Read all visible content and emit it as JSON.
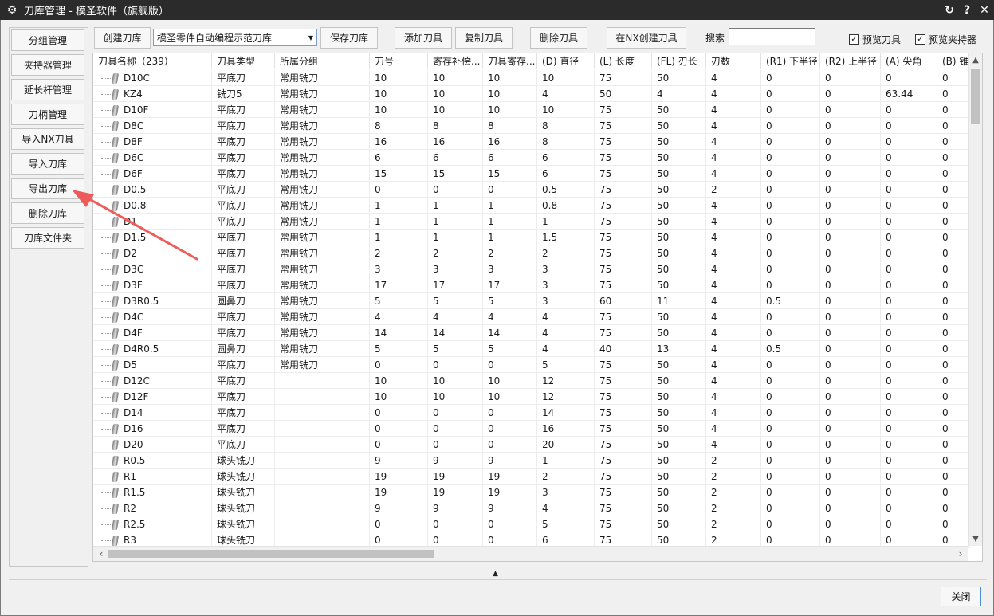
{
  "window": {
    "title": "刀库管理 - 模圣软件（旗舰版）",
    "controls": [
      "↻",
      "?",
      "✕"
    ]
  },
  "sidebar": {
    "items": [
      {
        "label": "分组管理"
      },
      {
        "label": "夹持器管理"
      },
      {
        "label": "延长杆管理"
      },
      {
        "label": "刀柄管理"
      },
      {
        "label": "导入NX刀具"
      },
      {
        "label": "导入刀库"
      },
      {
        "label": "导出刀库"
      },
      {
        "label": "删除刀库"
      },
      {
        "label": "刀库文件夹"
      }
    ]
  },
  "toolbar": {
    "create_library": "创建刀库",
    "library_select": "模圣零件自动编程示范刀库",
    "save_library": "保存刀库",
    "add_tool": "添加刀具",
    "copy_tool": "复制刀具",
    "delete_tool": "删除刀具",
    "create_in_nx": "在NX创建刀具",
    "search_label": "搜索",
    "search_value": "",
    "preview_tool": "预览刀具",
    "preview_holder": "预览夹持器"
  },
  "table": {
    "columns": [
      "刀具名称（239）",
      "刀具类型",
      "所属分组",
      "刀号",
      "寄存补偿...",
      "刀具寄存...",
      "(D) 直径",
      "(L) 长度",
      "(FL) 刃长",
      "刃数",
      "(R1) 下半径",
      "(R2) 上半径",
      "(A) 尖角",
      "(B) 锥角"
    ],
    "rows": [
      [
        "D10C",
        "平底刀",
        "常用铣刀",
        "10",
        "10",
        "10",
        "10",
        "75",
        "50",
        "4",
        "0",
        "0",
        "0",
        "0"
      ],
      [
        "KZ4",
        "铣刀5",
        "常用铣刀",
        "10",
        "10",
        "10",
        "4",
        "50",
        "4",
        "4",
        "0",
        "0",
        "63.44",
        "0"
      ],
      [
        "D10F",
        "平底刀",
        "常用铣刀",
        "10",
        "10",
        "10",
        "10",
        "75",
        "50",
        "4",
        "0",
        "0",
        "0",
        "0"
      ],
      [
        "D8C",
        "平底刀",
        "常用铣刀",
        "8",
        "8",
        "8",
        "8",
        "75",
        "50",
        "4",
        "0",
        "0",
        "0",
        "0"
      ],
      [
        "D8F",
        "平底刀",
        "常用铣刀",
        "16",
        "16",
        "16",
        "8",
        "75",
        "50",
        "4",
        "0",
        "0",
        "0",
        "0"
      ],
      [
        "D6C",
        "平底刀",
        "常用铣刀",
        "6",
        "6",
        "6",
        "6",
        "75",
        "50",
        "4",
        "0",
        "0",
        "0",
        "0"
      ],
      [
        "D6F",
        "平底刀",
        "常用铣刀",
        "15",
        "15",
        "15",
        "6",
        "75",
        "50",
        "4",
        "0",
        "0",
        "0",
        "0"
      ],
      [
        "D0.5",
        "平底刀",
        "常用铣刀",
        "0",
        "0",
        "0",
        "0.5",
        "75",
        "50",
        "2",
        "0",
        "0",
        "0",
        "0"
      ],
      [
        "D0.8",
        "平底刀",
        "常用铣刀",
        "1",
        "1",
        "1",
        "0.8",
        "75",
        "50",
        "4",
        "0",
        "0",
        "0",
        "0"
      ],
      [
        "D1",
        "平底刀",
        "常用铣刀",
        "1",
        "1",
        "1",
        "1",
        "75",
        "50",
        "4",
        "0",
        "0",
        "0",
        "0"
      ],
      [
        "D1.5",
        "平底刀",
        "常用铣刀",
        "1",
        "1",
        "1",
        "1.5",
        "75",
        "50",
        "4",
        "0",
        "0",
        "0",
        "0"
      ],
      [
        "D2",
        "平底刀",
        "常用铣刀",
        "2",
        "2",
        "2",
        "2",
        "75",
        "50",
        "4",
        "0",
        "0",
        "0",
        "0"
      ],
      [
        "D3C",
        "平底刀",
        "常用铣刀",
        "3",
        "3",
        "3",
        "3",
        "75",
        "50",
        "4",
        "0",
        "0",
        "0",
        "0"
      ],
      [
        "D3F",
        "平底刀",
        "常用铣刀",
        "17",
        "17",
        "17",
        "3",
        "75",
        "50",
        "4",
        "0",
        "0",
        "0",
        "0"
      ],
      [
        "D3R0.5",
        "圆鼻刀",
        "常用铣刀",
        "5",
        "5",
        "5",
        "3",
        "60",
        "11",
        "4",
        "0.5",
        "0",
        "0",
        "0"
      ],
      [
        "D4C",
        "平底刀",
        "常用铣刀",
        "4",
        "4",
        "4",
        "4",
        "75",
        "50",
        "4",
        "0",
        "0",
        "0",
        "0"
      ],
      [
        "D4F",
        "平底刀",
        "常用铣刀",
        "14",
        "14",
        "14",
        "4",
        "75",
        "50",
        "4",
        "0",
        "0",
        "0",
        "0"
      ],
      [
        "D4R0.5",
        "圆鼻刀",
        "常用铣刀",
        "5",
        "5",
        "5",
        "4",
        "40",
        "13",
        "4",
        "0.5",
        "0",
        "0",
        "0"
      ],
      [
        "D5",
        "平底刀",
        "常用铣刀",
        "0",
        "0",
        "0",
        "5",
        "75",
        "50",
        "4",
        "0",
        "0",
        "0",
        "0"
      ],
      [
        "D12C",
        "平底刀",
        "",
        "10",
        "10",
        "10",
        "12",
        "75",
        "50",
        "4",
        "0",
        "0",
        "0",
        "0"
      ],
      [
        "D12F",
        "平底刀",
        "",
        "10",
        "10",
        "10",
        "12",
        "75",
        "50",
        "4",
        "0",
        "0",
        "0",
        "0"
      ],
      [
        "D14",
        "平底刀",
        "",
        "0",
        "0",
        "0",
        "14",
        "75",
        "50",
        "4",
        "0",
        "0",
        "0",
        "0"
      ],
      [
        "D16",
        "平底刀",
        "",
        "0",
        "0",
        "0",
        "16",
        "75",
        "50",
        "4",
        "0",
        "0",
        "0",
        "0"
      ],
      [
        "D20",
        "平底刀",
        "",
        "0",
        "0",
        "0",
        "20",
        "75",
        "50",
        "4",
        "0",
        "0",
        "0",
        "0"
      ],
      [
        "R0.5",
        "球头铣刀",
        "",
        "9",
        "9",
        "9",
        "1",
        "75",
        "50",
        "2",
        "0",
        "0",
        "0",
        "0"
      ],
      [
        "R1",
        "球头铣刀",
        "",
        "19",
        "19",
        "19",
        "2",
        "75",
        "50",
        "2",
        "0",
        "0",
        "0",
        "0"
      ],
      [
        "R1.5",
        "球头铣刀",
        "",
        "19",
        "19",
        "19",
        "3",
        "75",
        "50",
        "2",
        "0",
        "0",
        "0",
        "0"
      ],
      [
        "R2",
        "球头铣刀",
        "",
        "9",
        "9",
        "9",
        "4",
        "75",
        "50",
        "2",
        "0",
        "0",
        "0",
        "0"
      ],
      [
        "R2.5",
        "球头铣刀",
        "",
        "0",
        "0",
        "0",
        "5",
        "75",
        "50",
        "2",
        "0",
        "0",
        "0",
        "0"
      ],
      [
        "R3",
        "球头铣刀",
        "",
        "0",
        "0",
        "0",
        "6",
        "75",
        "50",
        "2",
        "0",
        "0",
        "0",
        "0"
      ]
    ]
  },
  "footer": {
    "close": "关闭"
  },
  "colors": {
    "titlebar": "#2b2b2b",
    "annotation_arrow": "#ef5a5a",
    "focus_border": "#4a90d9"
  }
}
